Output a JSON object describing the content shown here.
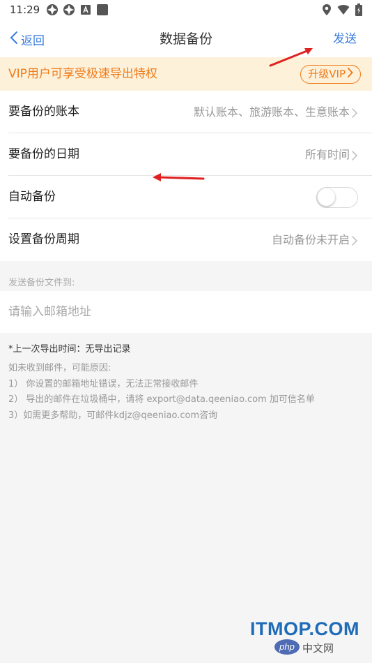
{
  "status_bar": {
    "time": "11:29"
  },
  "nav": {
    "back_label": "返回",
    "title": "数据备份",
    "send_label": "发送"
  },
  "vip": {
    "text": "VIP用户可享受极速导出特权",
    "button_label": "升级VIP"
  },
  "settings": {
    "items": [
      {
        "label": "要备份的账本",
        "value": "默认账本、旅游账本、生意账本"
      },
      {
        "label": "要备份的日期",
        "value": "所有时间"
      },
      {
        "label": "自动备份",
        "toggle_on": false
      },
      {
        "label": "设置备份周期",
        "value": "自动备份未开启"
      }
    ]
  },
  "email": {
    "section_label": "发送备份文件到:",
    "placeholder": "请输入邮箱地址"
  },
  "export_info": {
    "last_export": "*上一次导出时间：无导出记录"
  },
  "help": {
    "title": "如未收到邮件，可能原因:",
    "reason_1": "1） 你设置的邮箱地址错误，无法正常接收邮件",
    "reason_2": "2） 导出的邮件在垃圾桶中，请将 export@data.qeeniao.com 加可信名单",
    "reason_3": "3）如需更多帮助，可邮件kdjz@qeeniao.com咨询"
  },
  "watermark": {
    "site": "ITMOP.COM",
    "badge": "php",
    "cn": "中文网"
  },
  "colors": {
    "accent_blue": "#3a7ddc",
    "vip_orange": "#f07b1a",
    "vip_background": "#fdf1da",
    "annotation_red": "#e02020"
  }
}
